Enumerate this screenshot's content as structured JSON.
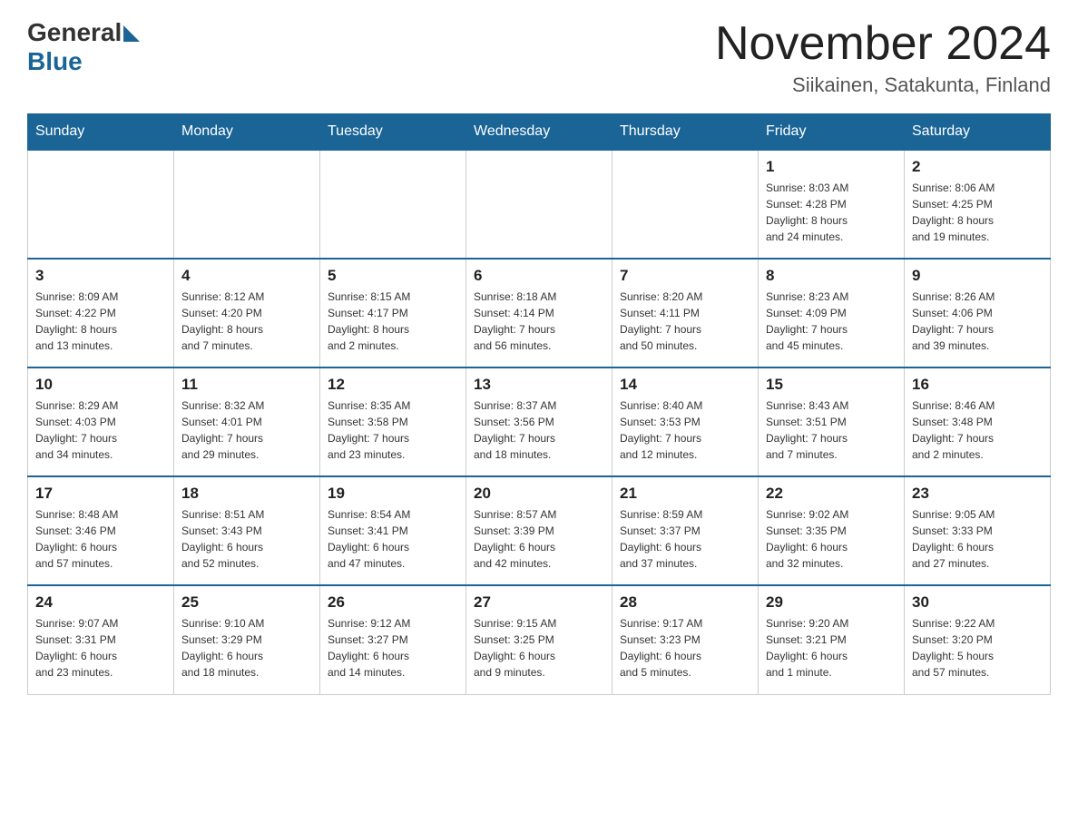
{
  "header": {
    "logo_general": "General",
    "logo_blue": "Blue",
    "month_title": "November 2024",
    "location": "Siikainen, Satakunta, Finland"
  },
  "weekdays": [
    "Sunday",
    "Monday",
    "Tuesday",
    "Wednesday",
    "Thursday",
    "Friday",
    "Saturday"
  ],
  "weeks": [
    [
      {
        "day": "",
        "info": ""
      },
      {
        "day": "",
        "info": ""
      },
      {
        "day": "",
        "info": ""
      },
      {
        "day": "",
        "info": ""
      },
      {
        "day": "",
        "info": ""
      },
      {
        "day": "1",
        "info": "Sunrise: 8:03 AM\nSunset: 4:28 PM\nDaylight: 8 hours\nand 24 minutes."
      },
      {
        "day": "2",
        "info": "Sunrise: 8:06 AM\nSunset: 4:25 PM\nDaylight: 8 hours\nand 19 minutes."
      }
    ],
    [
      {
        "day": "3",
        "info": "Sunrise: 8:09 AM\nSunset: 4:22 PM\nDaylight: 8 hours\nand 13 minutes."
      },
      {
        "day": "4",
        "info": "Sunrise: 8:12 AM\nSunset: 4:20 PM\nDaylight: 8 hours\nand 7 minutes."
      },
      {
        "day": "5",
        "info": "Sunrise: 8:15 AM\nSunset: 4:17 PM\nDaylight: 8 hours\nand 2 minutes."
      },
      {
        "day": "6",
        "info": "Sunrise: 8:18 AM\nSunset: 4:14 PM\nDaylight: 7 hours\nand 56 minutes."
      },
      {
        "day": "7",
        "info": "Sunrise: 8:20 AM\nSunset: 4:11 PM\nDaylight: 7 hours\nand 50 minutes."
      },
      {
        "day": "8",
        "info": "Sunrise: 8:23 AM\nSunset: 4:09 PM\nDaylight: 7 hours\nand 45 minutes."
      },
      {
        "day": "9",
        "info": "Sunrise: 8:26 AM\nSunset: 4:06 PM\nDaylight: 7 hours\nand 39 minutes."
      }
    ],
    [
      {
        "day": "10",
        "info": "Sunrise: 8:29 AM\nSunset: 4:03 PM\nDaylight: 7 hours\nand 34 minutes."
      },
      {
        "day": "11",
        "info": "Sunrise: 8:32 AM\nSunset: 4:01 PM\nDaylight: 7 hours\nand 29 minutes."
      },
      {
        "day": "12",
        "info": "Sunrise: 8:35 AM\nSunset: 3:58 PM\nDaylight: 7 hours\nand 23 minutes."
      },
      {
        "day": "13",
        "info": "Sunrise: 8:37 AM\nSunset: 3:56 PM\nDaylight: 7 hours\nand 18 minutes."
      },
      {
        "day": "14",
        "info": "Sunrise: 8:40 AM\nSunset: 3:53 PM\nDaylight: 7 hours\nand 12 minutes."
      },
      {
        "day": "15",
        "info": "Sunrise: 8:43 AM\nSunset: 3:51 PM\nDaylight: 7 hours\nand 7 minutes."
      },
      {
        "day": "16",
        "info": "Sunrise: 8:46 AM\nSunset: 3:48 PM\nDaylight: 7 hours\nand 2 minutes."
      }
    ],
    [
      {
        "day": "17",
        "info": "Sunrise: 8:48 AM\nSunset: 3:46 PM\nDaylight: 6 hours\nand 57 minutes."
      },
      {
        "day": "18",
        "info": "Sunrise: 8:51 AM\nSunset: 3:43 PM\nDaylight: 6 hours\nand 52 minutes."
      },
      {
        "day": "19",
        "info": "Sunrise: 8:54 AM\nSunset: 3:41 PM\nDaylight: 6 hours\nand 47 minutes."
      },
      {
        "day": "20",
        "info": "Sunrise: 8:57 AM\nSunset: 3:39 PM\nDaylight: 6 hours\nand 42 minutes."
      },
      {
        "day": "21",
        "info": "Sunrise: 8:59 AM\nSunset: 3:37 PM\nDaylight: 6 hours\nand 37 minutes."
      },
      {
        "day": "22",
        "info": "Sunrise: 9:02 AM\nSunset: 3:35 PM\nDaylight: 6 hours\nand 32 minutes."
      },
      {
        "day": "23",
        "info": "Sunrise: 9:05 AM\nSunset: 3:33 PM\nDaylight: 6 hours\nand 27 minutes."
      }
    ],
    [
      {
        "day": "24",
        "info": "Sunrise: 9:07 AM\nSunset: 3:31 PM\nDaylight: 6 hours\nand 23 minutes."
      },
      {
        "day": "25",
        "info": "Sunrise: 9:10 AM\nSunset: 3:29 PM\nDaylight: 6 hours\nand 18 minutes."
      },
      {
        "day": "26",
        "info": "Sunrise: 9:12 AM\nSunset: 3:27 PM\nDaylight: 6 hours\nand 14 minutes."
      },
      {
        "day": "27",
        "info": "Sunrise: 9:15 AM\nSunset: 3:25 PM\nDaylight: 6 hours\nand 9 minutes."
      },
      {
        "day": "28",
        "info": "Sunrise: 9:17 AM\nSunset: 3:23 PM\nDaylight: 6 hours\nand 5 minutes."
      },
      {
        "day": "29",
        "info": "Sunrise: 9:20 AM\nSunset: 3:21 PM\nDaylight: 6 hours\nand 1 minute."
      },
      {
        "day": "30",
        "info": "Sunrise: 9:22 AM\nSunset: 3:20 PM\nDaylight: 5 hours\nand 57 minutes."
      }
    ]
  ]
}
